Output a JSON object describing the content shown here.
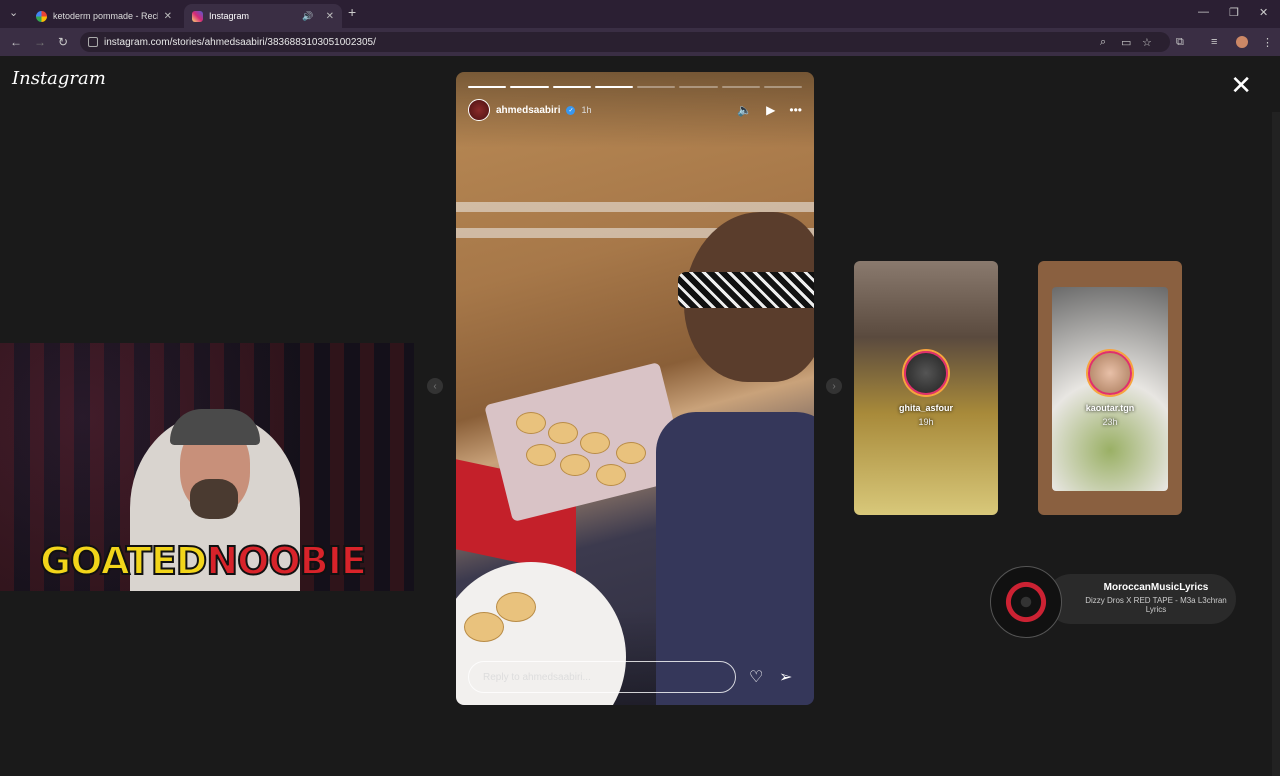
{
  "browser": {
    "tabs": [
      {
        "title": "ketoderm pommade - Recherch",
        "icon": "google-icon",
        "active": false
      },
      {
        "title": "Instagram",
        "icon": "instagram-icon",
        "active": true
      }
    ],
    "url": "instagram.com/stories/ahmedsaabiri/3836883103051002305/"
  },
  "instagram": {
    "logo": "Instagram",
    "story": {
      "username": "ahmedsaabiri",
      "time": "1h",
      "reply_placeholder": "Reply to ahmedsaabiri...",
      "progress": {
        "segments": 8,
        "completed": 4
      }
    },
    "previews": [
      {
        "username": "ghita_asfour",
        "time": "19h"
      },
      {
        "username": "kaoutar.tgn",
        "time": "23h"
      }
    ]
  },
  "overlay": {
    "brand_left": "GOATED",
    "brand_right": "NOOBIE",
    "music": {
      "artist": "MoroccanMusicLyrics",
      "track": "Dizzy Dros X RED TAPE - M3a L3chran Lyrics"
    }
  },
  "colors": {
    "tab_bar": "#2b1f33",
    "toolbar": "#3a2e44",
    "page_bg": "#1a1a1a",
    "brand_yellow": "#f2d51a",
    "brand_red": "#d8232a"
  }
}
